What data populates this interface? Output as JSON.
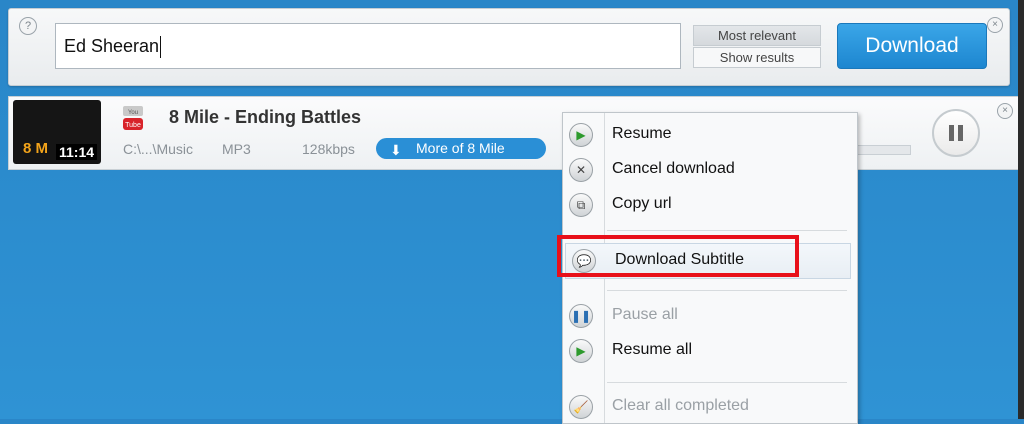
{
  "search": {
    "value": "Ed Sheeran"
  },
  "topbar": {
    "help": "?",
    "close": "×",
    "sort_options": [
      "Most relevant",
      "Show results"
    ],
    "download_label": "Download"
  },
  "item": {
    "thumb_text": "8 M",
    "duration": "11:14",
    "title": "8 Mile - Ending Battles",
    "path": "C:\\...\\Music",
    "format": "MP3",
    "bitrate": "128kbps",
    "more_label": "More of 8 Mile",
    "progress": 0.0,
    "close": "×"
  },
  "context_menu": {
    "items": [
      {
        "label": "Resume",
        "icon": "resume-icon",
        "disabled": false
      },
      {
        "label": "Cancel download",
        "icon": "cancel-icon",
        "disabled": false
      },
      {
        "label": "Copy url",
        "icon": "copy-icon",
        "disabled": false
      },
      {
        "label": "Download Subtitle",
        "icon": "subtitle-icon",
        "disabled": false,
        "highlighted": true
      },
      {
        "label": "Pause all",
        "icon": "pause-icon",
        "disabled": true
      },
      {
        "label": "Resume all",
        "icon": "resume-icon",
        "disabled": false
      },
      {
        "label": "Clear all completed",
        "icon": "clear-icon",
        "disabled": true
      }
    ]
  },
  "colors": {
    "accent": "#1d86d0",
    "highlight_box": "#e8101a"
  }
}
